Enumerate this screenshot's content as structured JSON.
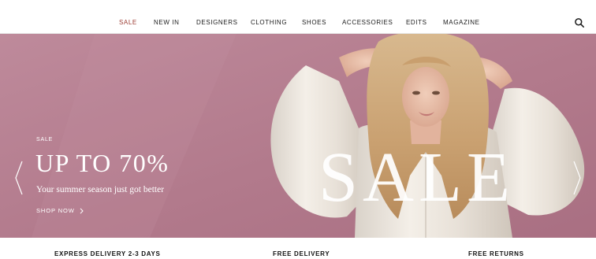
{
  "nav": {
    "items": [
      {
        "label": "SALE"
      },
      {
        "label": "NEW IN"
      },
      {
        "label": "DESIGNERS"
      },
      {
        "label": "CLOTHING"
      },
      {
        "label": "SHOES"
      },
      {
        "label": "ACCESSORIES"
      },
      {
        "label": "EDITS"
      },
      {
        "label": "MAGAZINE"
      }
    ],
    "search_icon": "search-icon"
  },
  "hero": {
    "kicker": "SALE",
    "headline": "UP TO 70%",
    "subline": "Your summer season just got better",
    "cta_label": "SHOP NOW",
    "overlay_word": "SALE",
    "background_color": "#b67e8f",
    "prev_icon": "chevron-left-icon",
    "next_icon": "chevron-right-icon"
  },
  "usp": {
    "items": [
      {
        "label": "EXPRESS DELIVERY 2-3 DAYS"
      },
      {
        "label": "FREE DELIVERY"
      },
      {
        "label": "FREE RETURNS"
      }
    ]
  },
  "colors": {
    "sale_accent": "#9b3b32",
    "text": "#1c1c1c"
  }
}
